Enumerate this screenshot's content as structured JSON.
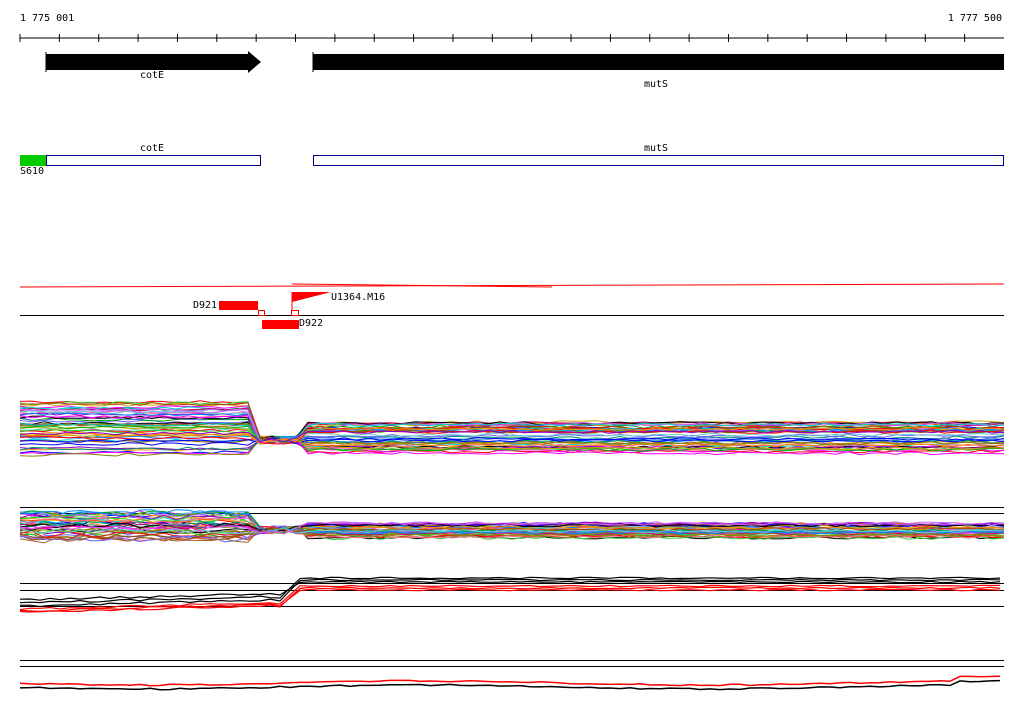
{
  "coordinates": {
    "start": "1 775 001",
    "end": "1 777 500"
  },
  "genes": [
    {
      "name": "cotE",
      "strand": "+"
    },
    {
      "name": "mutS",
      "strand": "+"
    }
  ],
  "annotation_track": {
    "features": [
      {
        "name": "cotE",
        "kind": "cds"
      },
      {
        "name": "mutS",
        "kind": "cds"
      },
      {
        "name": "S610",
        "kind": "promoter",
        "color": "#00cc00"
      }
    ]
  },
  "segments": [
    {
      "name": "D921",
      "color": "#ff0000"
    },
    {
      "name": "D922",
      "color": "#ff0000"
    },
    {
      "name": "U1364.M16",
      "color": "#ff0000"
    }
  ],
  "colors": {
    "gene_arrow": "#000000",
    "cds_outline": "#00008b",
    "promoter": "#00cc00",
    "segment": "#ff0000",
    "axis": "#000000"
  },
  "track_count": 4
}
